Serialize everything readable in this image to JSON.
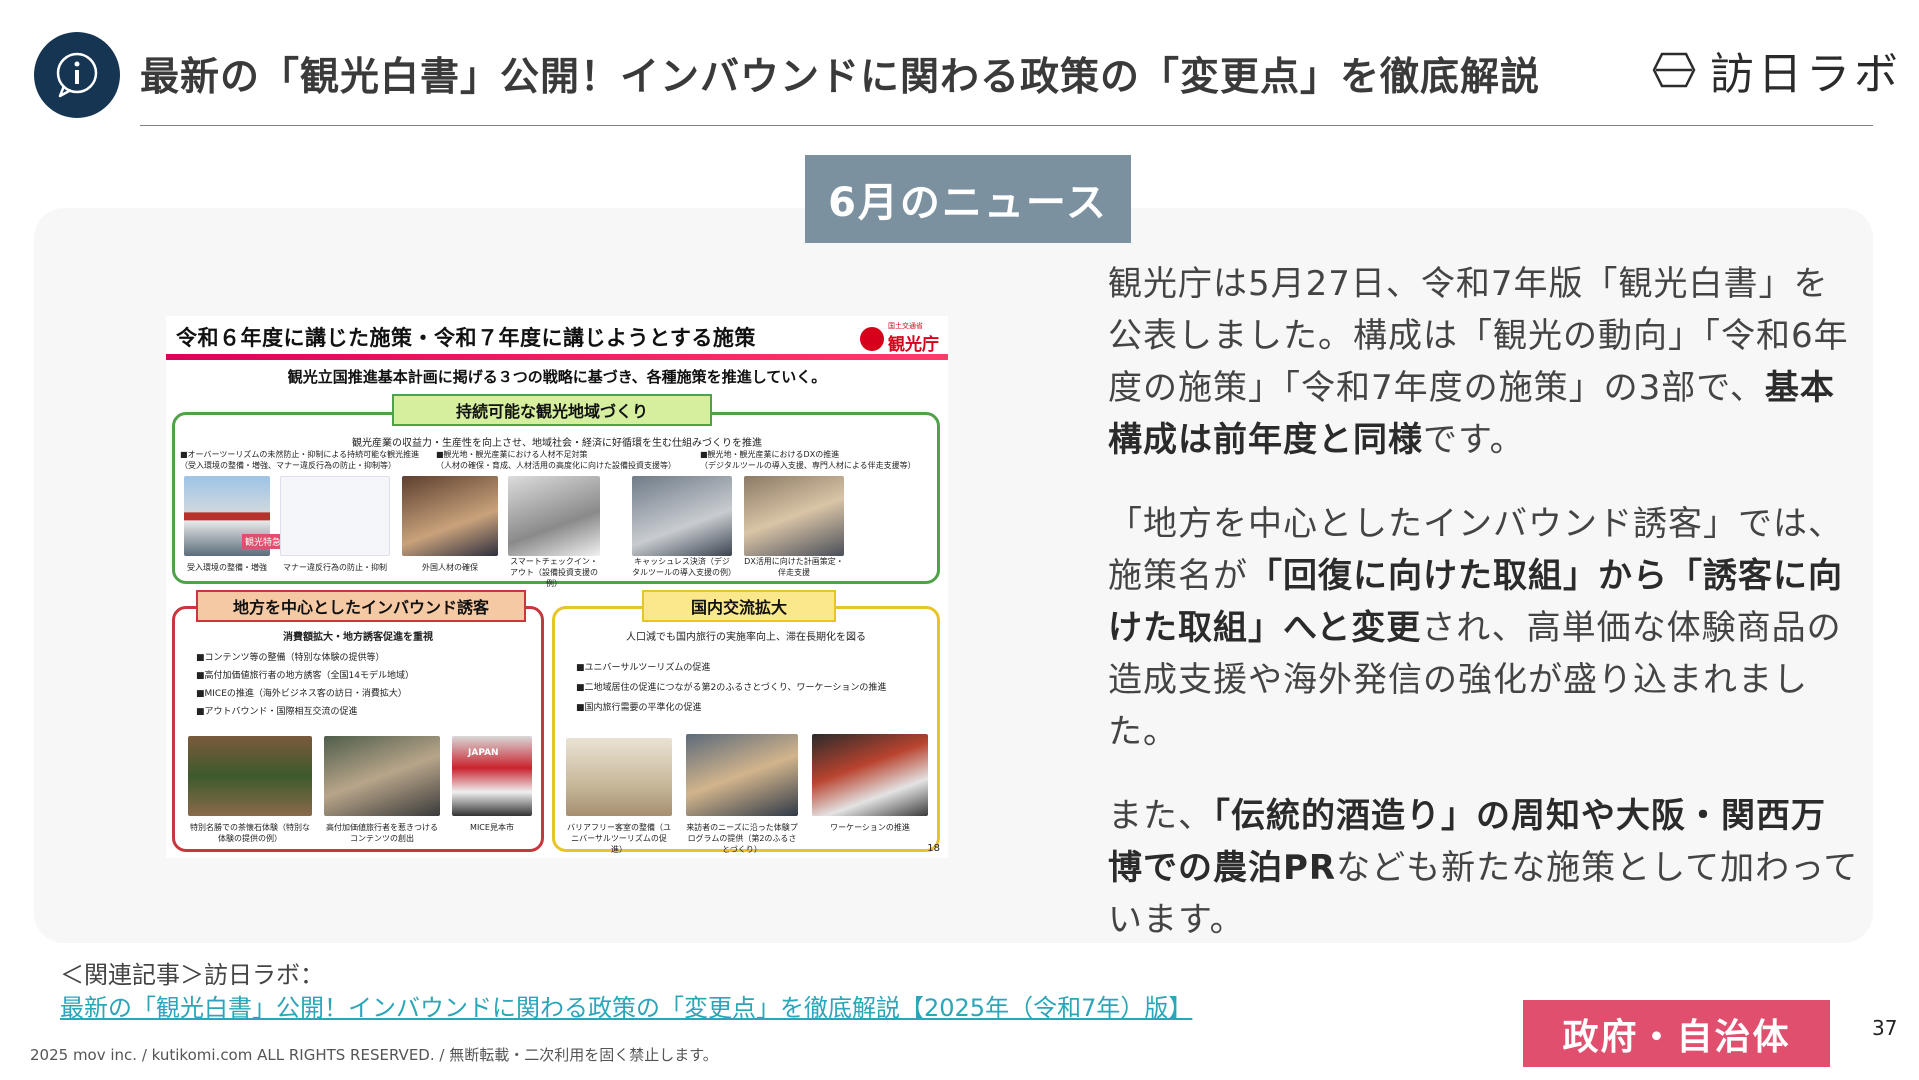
{
  "header": {
    "title": "最新の「観光白書」公開！インバウンドに関わる政策の「変更点」を徹底解説",
    "logo_text": "訪日ラボ"
  },
  "news_tag": "6月のニュース",
  "slide": {
    "title": "令和６年度に講じた施策・令和７年度に講じようとする施策",
    "logo_small": "国土交通省",
    "logo": "観光庁",
    "subtitle": "観光立国推進基本計画に掲げる３つの戦略に基づき、各種施策を推進していく。",
    "page": "18",
    "green": {
      "label": "持続可能な観光地域づくり",
      "lead": "観光産業の収益力・生産性を向上させ、地域社会・経済に好循環を生む仕組みづくりを推進",
      "col1a": "■オーバーツーリズムの未然防止・抑制による持続可能な観光推進",
      "col1b": "（受入環境の整備・増強、マナー違反行為の防止・抑制等）",
      "col2a": "■観光地・観光産業における人材不足対策",
      "col2b": "（人材の確保・育成、人材活用の高度化に向けた設備投資支援等）",
      "col3a": "■観光地・観光産業におけるDXの推進",
      "col3b": "（デジタルツールの導入支援、専門人材による伴走支援等）",
      "captions": [
        "受入環境の整備・増強",
        "マナー違反行為の防止・抑制",
        "外国人材の確保",
        "スマートチェックイン・アウト（設備投資支援の例）",
        "キャッシュレス決済（デジタルツールの導入支援の例）",
        "DX活用に向けた計画策定・伴走支援"
      ],
      "bus_label": "観光特急"
    },
    "red": {
      "label": "地方を中心としたインバウンド誘客",
      "lead": "消費額拡大・地方誘客促進を重視",
      "items": [
        "■コンテンツ等の整備（特別な体験の提供等）",
        "■高付加価値旅行者の地方誘客（全国14モデル地域）",
        "■MICEの推進（海外ビジネス客の訪日・消費拡大）",
        "■アウトバウンド・国際相互交流の促進"
      ],
      "captions": [
        "特別名勝での茶懐石体験（特別な体験の提供の例）",
        "高付加価値旅行者を惹きつけるコンテンツの創出",
        "MICE見本市"
      ],
      "sign": "JAPAN"
    },
    "yellow": {
      "label": "国内交流拡大",
      "lead": "人口減でも国内旅行の実施率向上、滞在長期化を図る",
      "items": [
        "■ユニバーサルツーリズムの促進",
        "■二地域居住の促進につながる第2のふるさとづくり、ワーケーションの推進",
        "■国内旅行需要の平準化の促進"
      ],
      "captions": [
        "バリアフリー客室の整備（ユニバーサルツーリズムの促進）",
        "来訪者のニーズに沿った体験プログラムの提供（第2のふるさとづくり）",
        "ワーケーションの推進"
      ]
    }
  },
  "body": {
    "p1_a": "観光庁は5月27日、令和7年版「観光白書」を公表しました。構成は「観光の動向」「令和6年度の施策」「令和7年度の施策」の3部で、",
    "p1_b": "基本構成は前年度と同様",
    "p1_c": "です。",
    "p2_a": "「地方を中心としたインバウンド誘客」では、施策名が",
    "p2_b": "「回復に向けた取組」から「誘客に向けた取組」へと変更",
    "p2_c": "され、高単価な体験商品の造成支援や海外発信の強化が盛り込まれました。",
    "p3_a": "また、",
    "p3_b": "「伝統的酒造り」の周知や大阪・関西万博での農泊PR",
    "p3_c": "なども新たな施策として加わっています。"
  },
  "related": {
    "label": "＜関連記事＞訪日ラボ：",
    "link": "最新の「観光白書」公開！インバウンドに関わる政策の「変更点」を徹底解説【2025年（令和7年）版】"
  },
  "footer": "2025 mov inc. / kutikomi.com ALL RIGHTS RESERVED. / 無断転載・二次利用を固く禁止します。",
  "category": "政府・自治体",
  "slide_number": "37",
  "colors": {
    "navy": "#163552",
    "tag": "#7c919f",
    "category": "#e0506e",
    "link": "#2aa6b8"
  }
}
